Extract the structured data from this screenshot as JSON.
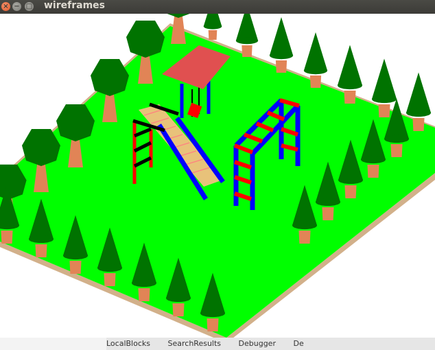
{
  "window": {
    "title": "wireframes",
    "close_symbol": "×",
    "minimize_symbol": "−",
    "maximize_symbol": "□"
  },
  "taskbar": {
    "items": [
      "LocalBlocks",
      "SearchResults",
      "Debugger",
      "De"
    ]
  },
  "colors": {
    "grass": "#00ff00",
    "ground_edge": "#d2b08a",
    "trunk": "#e18456",
    "foliage": "#007300",
    "red": "#ff0000",
    "blue": "#0000ff",
    "black": "#000000",
    "roof": "#e05050"
  }
}
